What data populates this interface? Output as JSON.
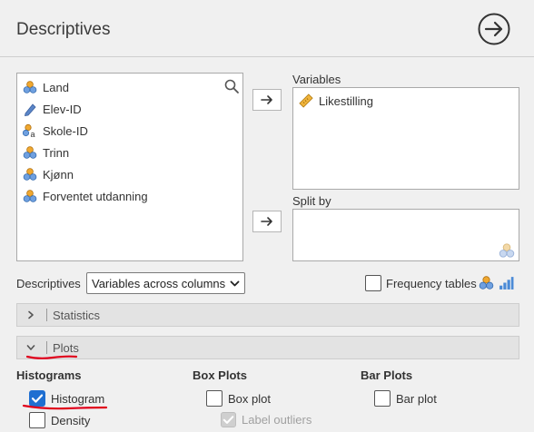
{
  "header": {
    "title": "Descriptives"
  },
  "variables_list": [
    {
      "label": "Land",
      "icon": "nominal-icon"
    },
    {
      "label": "Elev-ID",
      "icon": "continuous-icon"
    },
    {
      "label": "Skole-ID",
      "icon": "nominal-text-icon"
    },
    {
      "label": "Trinn",
      "icon": "nominal-icon"
    },
    {
      "label": "Kjønn",
      "icon": "nominal-icon"
    },
    {
      "label": "Forventet utdanning",
      "icon": "nominal-icon"
    }
  ],
  "variables_box": {
    "label": "Variables",
    "items": [
      {
        "label": "Likestilling",
        "icon": "ruler-icon"
      }
    ]
  },
  "splitby_box": {
    "label": "Split by"
  },
  "descriptives_row": {
    "label": "Descriptives",
    "select_value": "Variables across columns",
    "freq_label": "Frequency tables"
  },
  "sections": {
    "statistics": "Statistics",
    "plots": "Plots"
  },
  "plots": {
    "histograms_head": "Histograms",
    "boxplots_head": "Box Plots",
    "barplots_head": "Bar Plots",
    "histogram": {
      "label": "Histogram",
      "checked": true
    },
    "density": {
      "label": "Density",
      "checked": false
    },
    "boxplot": {
      "label": "Box plot",
      "checked": false
    },
    "label_outliers": {
      "label": "Label outliers",
      "checked": true,
      "disabled": true
    },
    "barplot": {
      "label": "Bar plot",
      "checked": false
    }
  },
  "colors": {
    "accent": "#1f6fd1",
    "annotation": "#e0001b"
  }
}
